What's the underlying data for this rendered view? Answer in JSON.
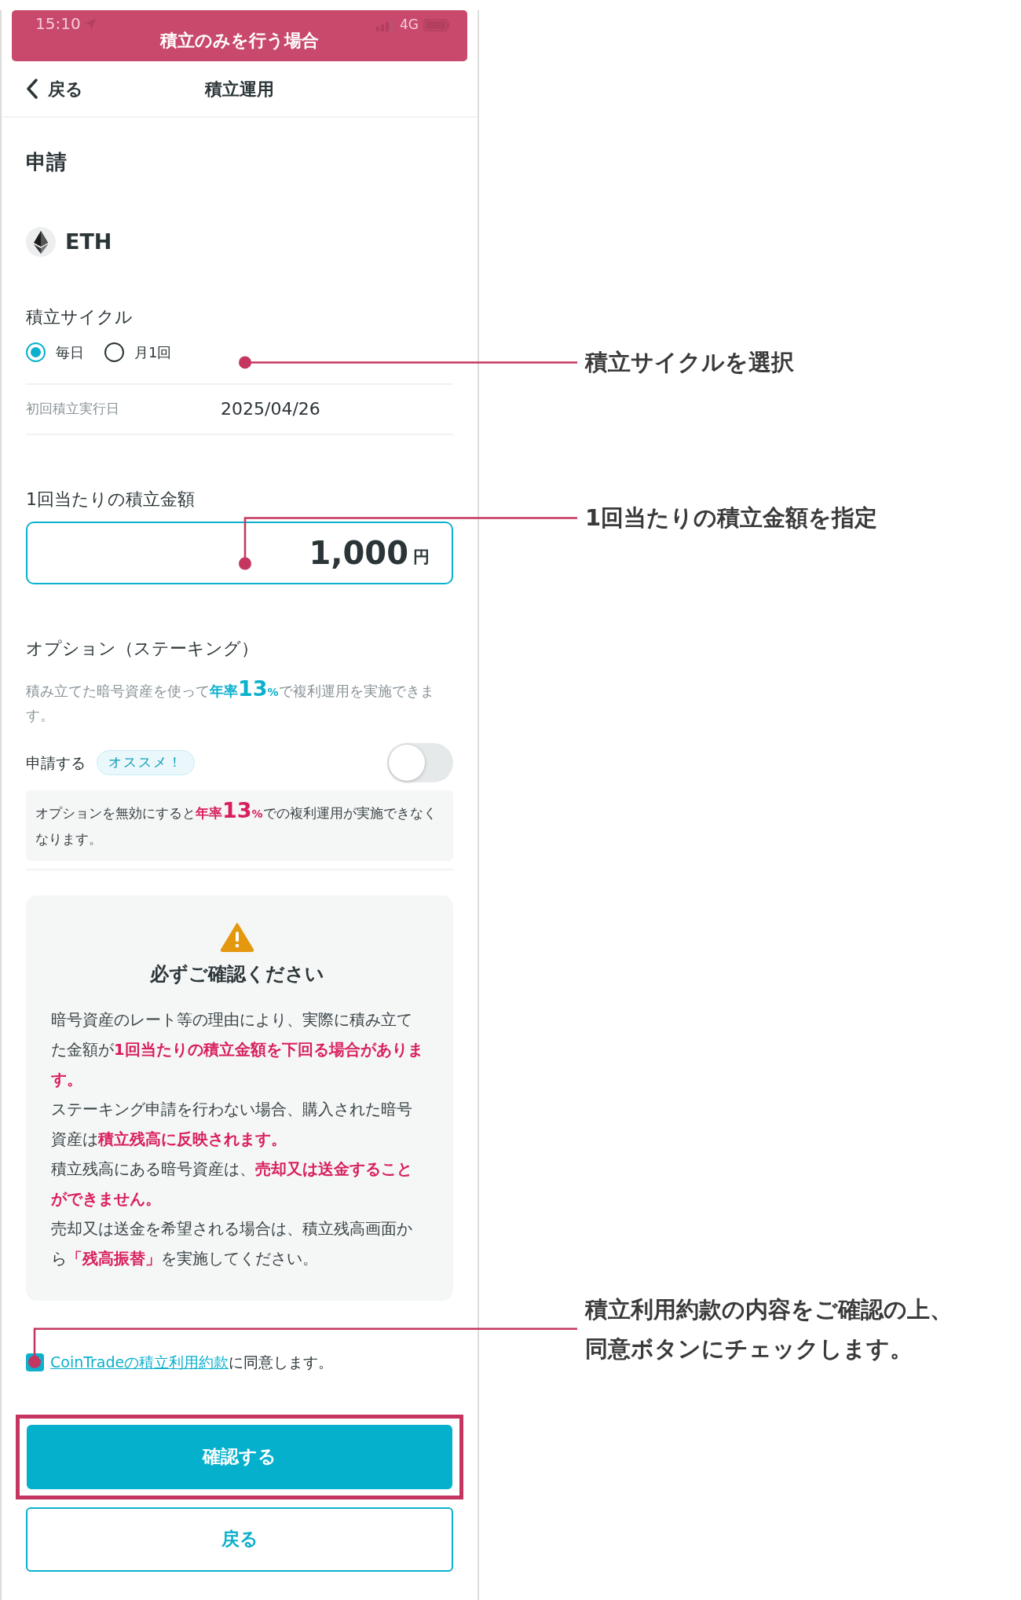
{
  "banner": {
    "title": "積立のみを行う場合"
  },
  "status_bar": {
    "time": "15:10",
    "network": "4G"
  },
  "nav": {
    "back": "戻る",
    "title": "積立運用"
  },
  "section_title": "申請",
  "asset": {
    "symbol": "ETH"
  },
  "cycle": {
    "label": "積立サイクル",
    "options": [
      {
        "label": "毎日",
        "selected": true
      },
      {
        "label": "月1回",
        "selected": false
      }
    ]
  },
  "first_date": {
    "label": "初回積立実行日",
    "value": "2025/04/26"
  },
  "amount": {
    "label": "1回当たりの積立金額",
    "value": "1,000",
    "unit": "円"
  },
  "option": {
    "title": "オプション（ステーキング）",
    "description": {
      "before": "積み立てた暗号資産を使って",
      "rate_prefix": "年率",
      "rate": "13",
      "rate_unit": "%",
      "after": "で複利運用を実施できます。"
    },
    "toggle": {
      "label": "申請する",
      "badge": "オススメ！",
      "on": false
    },
    "note": {
      "before": "オプションを無効にすると",
      "rate_prefix": "年率",
      "rate": "13",
      "rate_unit": "%",
      "after": "での複利運用が実施できなくなります。"
    }
  },
  "warning": {
    "title": "必ずご確認ください",
    "paragraphs": [
      "暗号資産のレート等の理由により、実際に積み立てた金額が**1回当たりの積立金額を下回る場合があります。**",
      "ステーキング申請を行わない場合、購入された暗号資産は**積立残高に反映されます。**",
      "積立残高にある暗号資産は、**売却又は送金することができません。**",
      "売却又は送金を希望される場合は、積立残高画面から**「残高振替」**を実施してください。"
    ]
  },
  "agree": {
    "checked": true,
    "link": "CoinTradeの積立利用約款",
    "text": "に同意します。"
  },
  "buttons": {
    "confirm": "確認する",
    "back": "戻る"
  },
  "annotations": [
    "積立サイクルを選択",
    "1回当たりの積立金額を指定",
    "積立利用約款の内容をご確認の上、同意ボタンにチェックします。"
  ]
}
